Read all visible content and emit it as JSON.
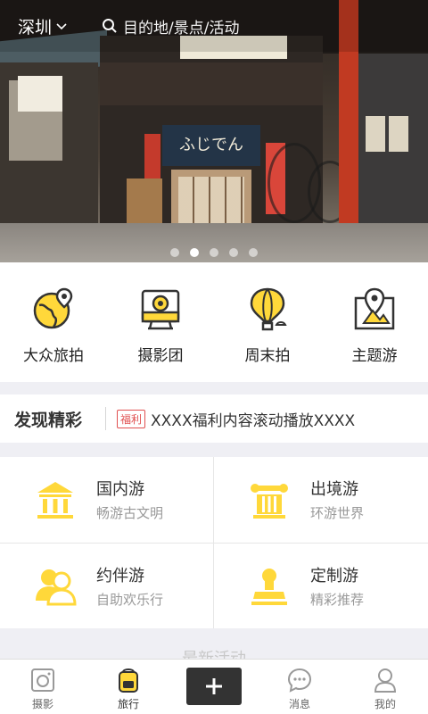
{
  "header": {
    "city": "深圳",
    "search_placeholder": "目的地/景点/活动"
  },
  "banner": {
    "slide_count": 5,
    "active_slide": 2,
    "sign_text": "ふじでん"
  },
  "categories": [
    {
      "label": "大众旅拍",
      "icon": "globe-pin-icon"
    },
    {
      "label": "摄影团",
      "icon": "camera-icon"
    },
    {
      "label": "周末拍",
      "icon": "hot-air-balloon-icon"
    },
    {
      "label": "主题游",
      "icon": "map-pin-icon"
    }
  ],
  "discover": {
    "title": "发现精彩",
    "tag": "福利",
    "message": "XXXX福利内容滚动播放XXXX"
  },
  "travel_types": [
    {
      "title": "国内游",
      "subtitle": "畅游古文明",
      "icon": "temple-icon"
    },
    {
      "title": "出境游",
      "subtitle": "环游世界",
      "icon": "column-icon"
    },
    {
      "title": "约伴游",
      "subtitle": "自助欢乐行",
      "icon": "companions-icon"
    },
    {
      "title": "定制游",
      "subtitle": "精彩推荐",
      "icon": "stamp-icon"
    }
  ],
  "section_heading": "最新活动",
  "tabbar": [
    {
      "label": "摄影",
      "icon": "photo-icon",
      "active": false
    },
    {
      "label": "旅行",
      "icon": "backpack-icon",
      "active": true
    },
    {
      "label": "",
      "icon": "plus-icon",
      "active": false
    },
    {
      "label": "消息",
      "icon": "chat-bubble-icon",
      "active": false
    },
    {
      "label": "我的",
      "icon": "person-icon",
      "active": false
    }
  ],
  "colors": {
    "accent_yellow": "#ffd83a",
    "icon_outline": "#333333",
    "tag_red": "#e05050",
    "page_bg": "#efeff4"
  }
}
